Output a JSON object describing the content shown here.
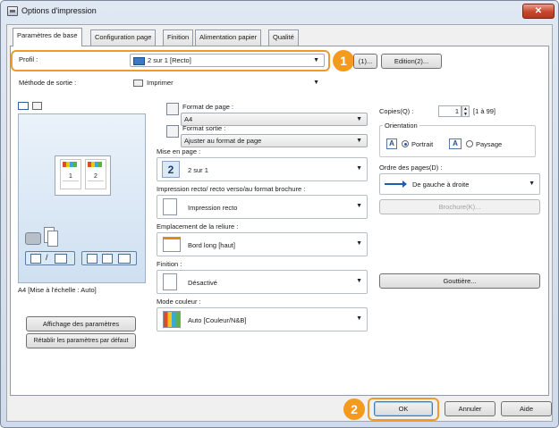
{
  "window": {
    "title": "Options d'impression",
    "close_glyph": "✕"
  },
  "tabs": [
    {
      "label": "Paramètres de base"
    },
    {
      "label": "Configuration page"
    },
    {
      "label": "Finition"
    },
    {
      "label": "Alimentation papier"
    },
    {
      "label": "Qualité"
    }
  ],
  "profile": {
    "label": "Profil :",
    "value": "2 sur 1 [Recto]",
    "add_button": "(1)...",
    "edit_button": "Edition(2)..."
  },
  "output_method": {
    "label": "Méthode de sortie :",
    "value": "Imprimer"
  },
  "preview": {
    "caption": "A4 [Mise à l'échelle : Auto]",
    "page_numbers": [
      "1",
      "2"
    ],
    "view_settings_button": "Affichage des paramètres",
    "restore_defaults_button": "Rétablir les paramètres par défaut"
  },
  "page_format": {
    "label": "Format de page :",
    "value": "A4"
  },
  "output_format": {
    "label": "Format sortie :",
    "value": "Ajuster au format de page"
  },
  "layout": {
    "label": "Mise en page :",
    "value": "2 sur 1",
    "icon_digit": "2"
  },
  "duplex": {
    "label": "Impression recto/ recto verso/au format brochure :",
    "value": "Impression recto"
  },
  "binding": {
    "label": "Emplacement de la reliure :",
    "value": "Bord long [haut]"
  },
  "finishing": {
    "label": "Finition :",
    "value": "Désactivé"
  },
  "color_mode": {
    "label": "Mode couleur :",
    "value": "Auto [Couleur/N&B]"
  },
  "copies": {
    "label": "Copies(Q) :",
    "value": "1",
    "range": "[1 à 99]"
  },
  "orientation": {
    "label": "Orientation",
    "portrait": "Portrait",
    "landscape": "Paysage",
    "selected": "Portrait"
  },
  "page_order": {
    "label": "Ordre des pages(D) :",
    "value": "De gauche à droite",
    "booklet_button": "Brochure(K)..."
  },
  "gutter_button": "Gouttière...",
  "footer": {
    "ok": "OK",
    "cancel": "Annuler",
    "help": "Aide"
  },
  "callouts": [
    "1",
    "2"
  ],
  "colors": {
    "accent": "#f39a1f",
    "title_bar": "#dfe8f3",
    "close": "#c7462d"
  }
}
